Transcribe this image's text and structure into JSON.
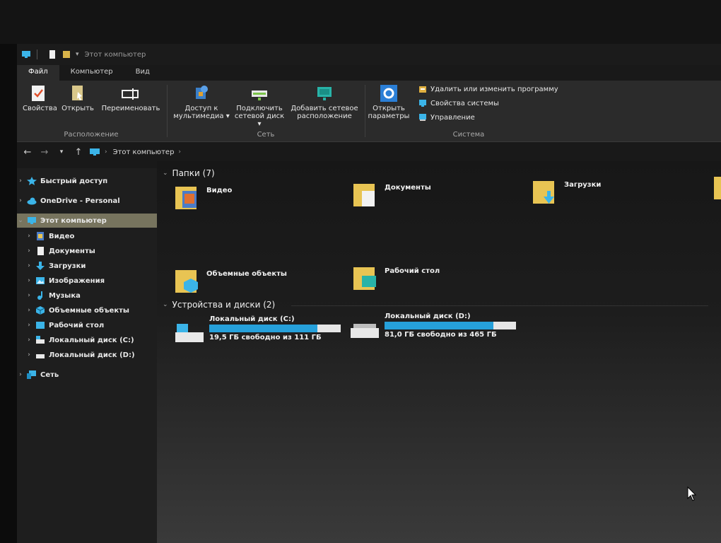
{
  "titlebar": {
    "title": "Этот компьютер"
  },
  "tabs": [
    "Файл",
    "Компьютер",
    "Вид"
  ],
  "ribbon": {
    "groups": [
      {
        "label": "Расположение",
        "buttons": [
          {
            "label": "Свойства",
            "icon": "properties-icon"
          },
          {
            "label": "Открыть",
            "icon": "open-icon"
          },
          {
            "label": "Переименовать",
            "icon": "rename-icon"
          }
        ]
      },
      {
        "label": "Сеть",
        "buttons": [
          {
            "label": "Доступ к мультимедиа ▾",
            "icon": "media-access-icon"
          },
          {
            "label": "Подключить сетевой диск ▾",
            "icon": "map-network-drive-icon"
          },
          {
            "label": "Добавить сетевое расположение",
            "icon": "add-network-location-icon"
          }
        ]
      },
      {
        "label": "Система",
        "buttons": [
          {
            "label": "Открыть параметры",
            "icon": "settings-gear-icon"
          }
        ],
        "small": [
          {
            "label": "Удалить или изменить программу",
            "icon": "uninstall-icon"
          },
          {
            "label": "Свойства системы",
            "icon": "system-properties-icon"
          },
          {
            "label": "Управление",
            "icon": "manage-icon"
          }
        ]
      }
    ]
  },
  "address": {
    "crumb": "Этот компьютер"
  },
  "sidebar": {
    "items": [
      {
        "label": "Быстрый доступ",
        "icon": "star-icon"
      },
      {
        "label": "OneDrive - Personal",
        "icon": "cloud-icon"
      },
      {
        "label": "Этот компьютер",
        "icon": "computer-icon"
      },
      {
        "label": "Видео",
        "icon": "video-icon"
      },
      {
        "label": "Документы",
        "icon": "document-icon"
      },
      {
        "label": "Загрузки",
        "icon": "download-icon"
      },
      {
        "label": "Изображения",
        "icon": "image-icon"
      },
      {
        "label": "Музыка",
        "icon": "music-icon"
      },
      {
        "label": "Объемные объекты",
        "icon": "3d-objects-icon"
      },
      {
        "label": "Рабочий стол",
        "icon": "desktop-icon"
      },
      {
        "label": "Локальный диск (C:)",
        "icon": "drive-icon"
      },
      {
        "label": "Локальный диск (D:)",
        "icon": "drive-icon"
      },
      {
        "label": "Сеть",
        "icon": "network-icon"
      }
    ]
  },
  "folders_section": {
    "title": "Папки (7)",
    "items": [
      {
        "label": "Видео",
        "icon": "video-folder-icon"
      },
      {
        "label": "Документы",
        "icon": "documents-folder-icon"
      },
      {
        "label": "Загрузки",
        "icon": "downloads-folder-icon"
      },
      {
        "label": "Объемные объекты",
        "icon": "3d-objects-folder-icon"
      },
      {
        "label": "Рабочий стол",
        "icon": "desktop-folder-icon"
      }
    ]
  },
  "drives_section": {
    "title": "Устройства и диски (2)",
    "items": [
      {
        "label": "Локальный диск (C:)",
        "free": "19,5 ГБ свободно из 111 ГБ",
        "used_fraction": 0.82,
        "icon": "system-drive-icon"
      },
      {
        "label": "Локальный диск (D:)",
        "free": "81,0 ГБ свободно из 465 ГБ",
        "used_fraction": 0.83,
        "icon": "hard-drive-icon"
      }
    ]
  },
  "colors": {
    "accent": "#26a0da",
    "folder": "#e8c453",
    "selection": "#77745e"
  }
}
